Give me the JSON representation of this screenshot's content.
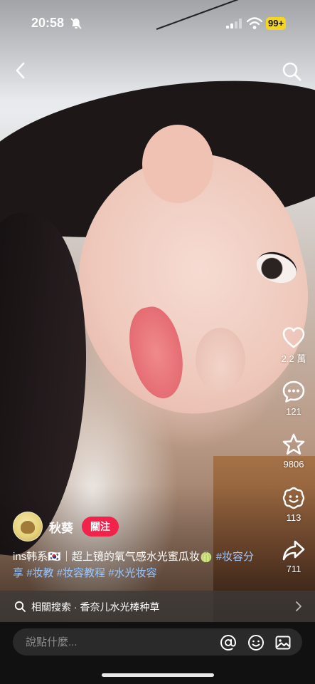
{
  "status_bar": {
    "time": "20:58",
    "battery": "99+",
    "battery_color": "#f5d51e"
  },
  "actions": {
    "like_count": "2.2 萬",
    "comment_count": "121",
    "favorite_count": "9806",
    "emoji_count": "113",
    "share_count": "711"
  },
  "author": {
    "name": "秋葵",
    "follow_label": "關注",
    "follow_color": "#f2234b"
  },
  "caption": {
    "text": "ins韩系🇰🇷｜超上镜的氧气感水光蜜瓜妆🍈",
    "tags": [
      "#妆容分享",
      "#妆教",
      "#妆容教程",
      "#水光妆容"
    ],
    "tag_color": "#9bc7ff"
  },
  "related_search": {
    "label": "相關搜索 · 香奈儿水光棒种草"
  },
  "comment_bar": {
    "placeholder": "說點什麼..."
  },
  "icons": [
    "back-icon",
    "search-icon",
    "heart-icon",
    "comment-icon",
    "star-icon",
    "emoji-icon",
    "share-icon",
    "at-icon",
    "smile-icon",
    "image-icon"
  ]
}
